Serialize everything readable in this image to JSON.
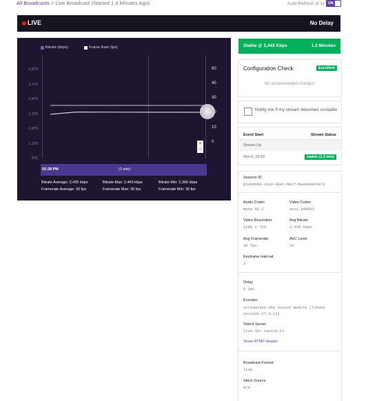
{
  "breadcrumb": {
    "all": "All Broadcasts",
    "sep": " > ",
    "current": "Live Broadcast (Started 1.4 Minutes Ago)"
  },
  "auto_refresh": {
    "label": "Auto-Refresh (8 s)",
    "toggle": "ON"
  },
  "live_bar": {
    "live_label": "LIVE",
    "delay_label": "No Delay"
  },
  "chart_data": {
    "type": "line",
    "title": "",
    "legend": [
      "Bitrate (kbps)",
      "Frame Rate (fps)"
    ],
    "legend_colors": [
      "#6d5fb0",
      "#ffffff"
    ],
    "y_left_ticks": [
      "3,875",
      "3,375",
      "2,875",
      "2,375",
      "1,875",
      "1,375",
      "875"
    ],
    "y_right_ticks": [
      "60",
      "40",
      "30",
      "20",
      "10",
      "0"
    ],
    "series": [
      {
        "name": "Bitrate (kbps)",
        "values": [
          2366,
          2443,
          2440,
          2438,
          2436,
          2435,
          2434
        ]
      },
      {
        "name": "Frame Rate (fps)",
        "values": [
          30,
          30,
          30,
          30,
          30,
          30,
          30
        ]
      }
    ],
    "timeline_start": "02:28 PM",
    "timeline_span": "(1 min)",
    "stats": {
      "bitrate_avg": "Bitrate Average: 2,435 kbps",
      "bitrate_max": "Bitrate Max: 2,443 kbps",
      "bitrate_min": "Bitrate Min: 2,366 kbps",
      "fps_avg": "Framerate Average: 30 fps",
      "fps_max": "Framerate Max: 30 fps",
      "fps_min": "Framerate Min: 30 fps"
    },
    "zoom_in": "+",
    "zoom_out": "−"
  },
  "status": {
    "label": "Stable @ 2,443 Kbps",
    "duration": "1.3 Minutes",
    "color": "#00b05a"
  },
  "config": {
    "title": "Configuration Check",
    "badge": "Excellent",
    "message": "No recommended changes!"
  },
  "notify": {
    "label": "Notify me if my stream becomes unstable"
  },
  "events": {
    "col_event": "Event Start",
    "col_status": "Stream Status",
    "event": "Stream Up",
    "date": "Nov 8, 15:29",
    "status_badge": "stable (1.3 min)"
  },
  "details": {
    "session_id_label": "Session ID",
    "session_id": "8136d6b8-c919-40ec-bbcf-baa3a8829e73",
    "audio_codec_label": "Audio Codec",
    "audio_codec": "mp4a.40.2",
    "video_codec_label": "Video Codec",
    "video_codec": "avc1.640015",
    "video_res_label": "Video Resolution",
    "video_res": "1280 x 720",
    "avg_bitrate_label": "Avg Bitrate",
    "avg_bitrate": "2,435 kbps",
    "avg_fps_label": "Avg Framerate",
    "avg_fps": "30 fps",
    "avc_level_label": "AVC Level",
    "avc_level": "31",
    "keyframe_label": "Keyframe Interval",
    "keyframe": "2",
    "delay_label": "Delay",
    "delay": "0 Sec",
    "encoder_label": "Encoder",
    "encoder": "streamlabs-obs output module (libobs version 27.0.12)",
    "server_label": "Twitch Server",
    "server": "live-lhr.twitch.tv",
    "rtmp_link": "Show RTMP Header",
    "format_label": "Broadcast Format",
    "format": "live",
    "source_label": "Stitch Source",
    "source": "N/A"
  }
}
